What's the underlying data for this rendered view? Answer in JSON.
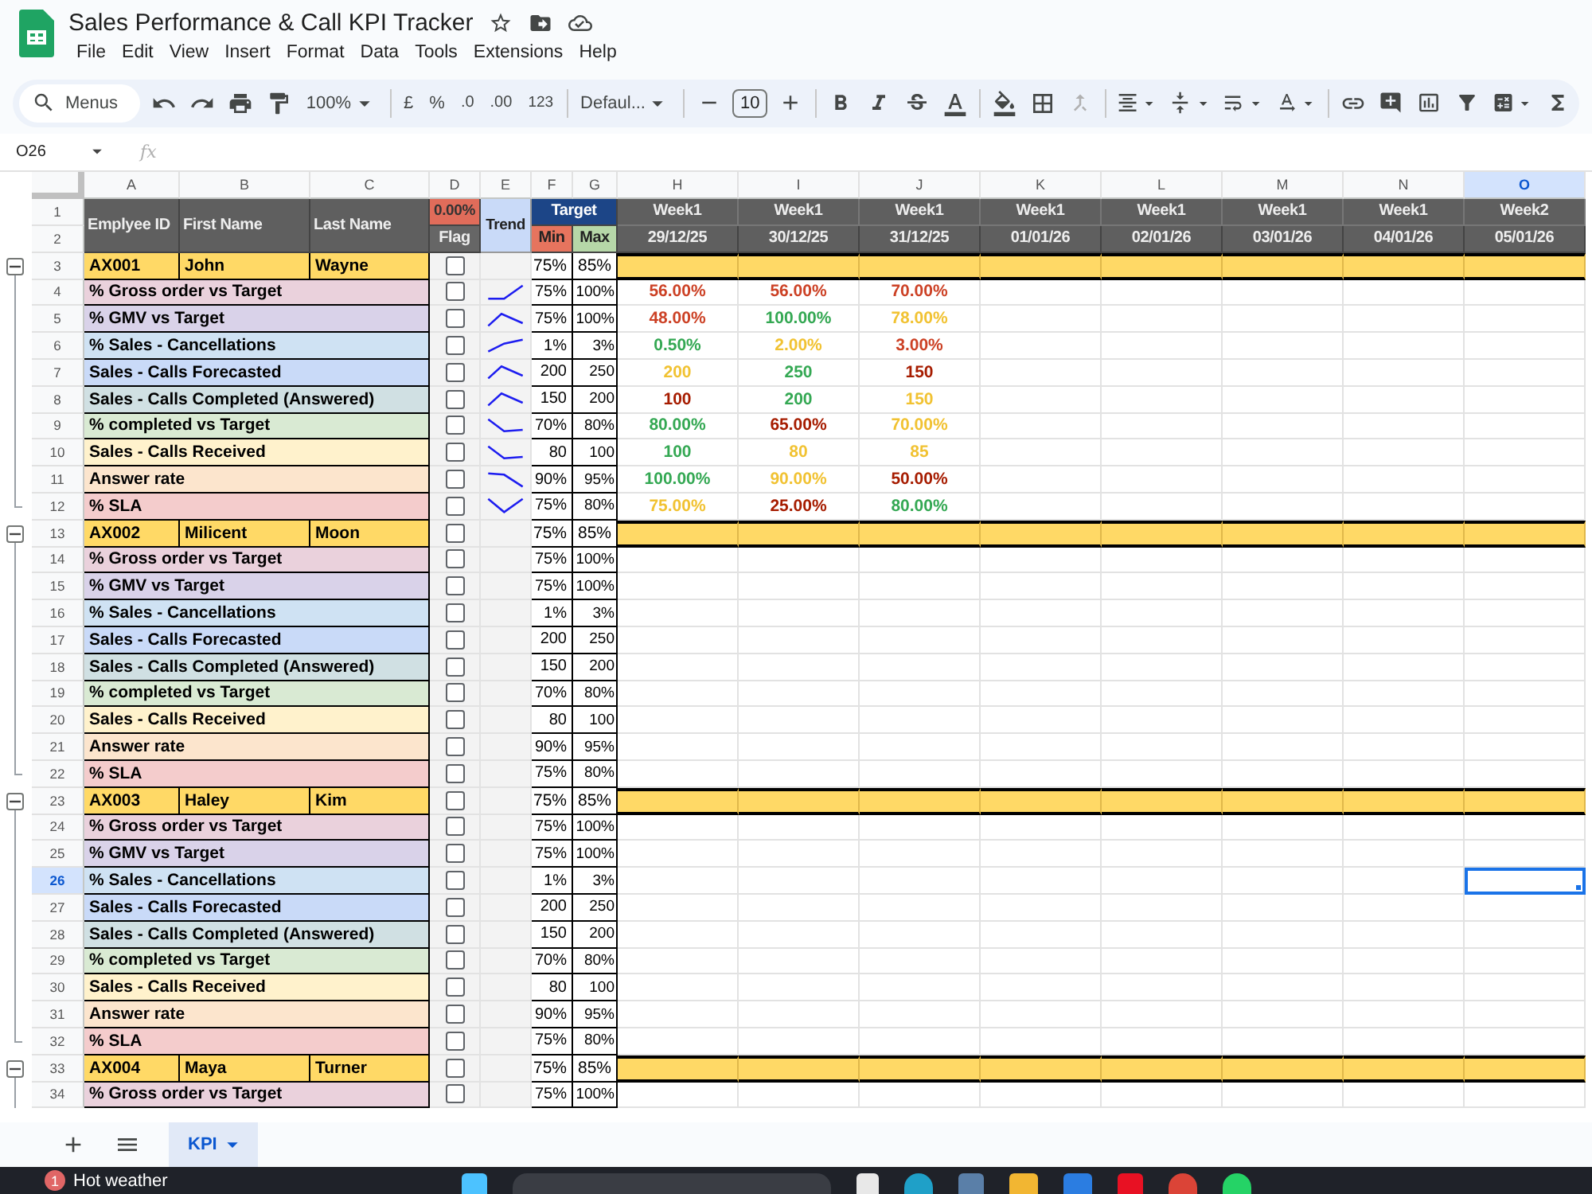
{
  "app": {
    "title": "Sales Performance & Call KPI Tracker"
  },
  "menu": [
    "File",
    "Edit",
    "View",
    "Insert",
    "Format",
    "Data",
    "Tools",
    "Extensions",
    "Help"
  ],
  "toolbar": {
    "search": "Menus",
    "zoom": "100%",
    "currency": "£",
    "percent": "%",
    "decrease_decimal": ".0",
    "increase_decimal": ".00",
    "number_format": "123",
    "font": "Defaul...",
    "font_size": "10"
  },
  "formula_bar": {
    "name_box": "O26",
    "label": "fx"
  },
  "columns": [
    {
      "label": "A",
      "selected": false
    },
    {
      "label": "B",
      "selected": false
    },
    {
      "label": "C",
      "selected": false
    },
    {
      "label": "D",
      "selected": false
    },
    {
      "label": "E",
      "selected": false
    },
    {
      "label": "F",
      "selected": false
    },
    {
      "label": "G",
      "selected": false
    },
    {
      "label": "H",
      "selected": false
    },
    {
      "label": "I",
      "selected": false
    },
    {
      "label": "J",
      "selected": false
    },
    {
      "label": "K",
      "selected": false
    },
    {
      "label": "L",
      "selected": false
    },
    {
      "label": "M",
      "selected": false
    },
    {
      "label": "N",
      "selected": false
    },
    {
      "label": "O",
      "selected": true
    }
  ],
  "header": {
    "employee_id": "Emplyee ID",
    "first_name": "First Name",
    "last_name": "Last Name",
    "flag_rate": "0.00%",
    "flag": "Flag",
    "trend": "Trend",
    "target": "Target",
    "min": "Min",
    "max": "Max"
  },
  "weeks": [
    {
      "week": "Week1",
      "date": "29/12/25"
    },
    {
      "week": "Week1",
      "date": "30/12/25"
    },
    {
      "week": "Week1",
      "date": "31/12/25"
    },
    {
      "week": "Week1",
      "date": "01/01/26"
    },
    {
      "week": "Week1",
      "date": "02/01/26"
    },
    {
      "week": "Week1",
      "date": "03/01/26"
    },
    {
      "week": "Week1",
      "date": "04/01/26"
    },
    {
      "week": "Week2",
      "date": "05/01/26"
    }
  ],
  "row_numbers": [
    {
      "label": "1",
      "selected": false
    },
    {
      "label": "2",
      "selected": false
    },
    {
      "label": "3",
      "selected": false
    },
    {
      "label": "4",
      "selected": false
    },
    {
      "label": "5",
      "selected": false
    },
    {
      "label": "6",
      "selected": false
    },
    {
      "label": "7",
      "selected": false
    },
    {
      "label": "8",
      "selected": false
    },
    {
      "label": "9",
      "selected": false
    },
    {
      "label": "10",
      "selected": false
    },
    {
      "label": "11",
      "selected": false
    },
    {
      "label": "12",
      "selected": false
    },
    {
      "label": "13",
      "selected": false
    },
    {
      "label": "14",
      "selected": false
    },
    {
      "label": "15",
      "selected": false
    },
    {
      "label": "16",
      "selected": false
    },
    {
      "label": "17",
      "selected": false
    },
    {
      "label": "18",
      "selected": false
    },
    {
      "label": "19",
      "selected": false
    },
    {
      "label": "20",
      "selected": false
    },
    {
      "label": "21",
      "selected": false
    },
    {
      "label": "22",
      "selected": false
    },
    {
      "label": "23",
      "selected": false
    },
    {
      "label": "24",
      "selected": false
    },
    {
      "label": "25",
      "selected": false
    },
    {
      "label": "26",
      "selected": true
    },
    {
      "label": "27",
      "selected": false
    },
    {
      "label": "28",
      "selected": false
    },
    {
      "label": "29",
      "selected": false
    },
    {
      "label": "30",
      "selected": false
    },
    {
      "label": "31",
      "selected": false
    },
    {
      "label": "32",
      "selected": false
    },
    {
      "label": "33",
      "selected": false
    },
    {
      "label": "34",
      "selected": false
    }
  ],
  "employees": [
    {
      "id": "AX001",
      "first_name": "John",
      "last_name": "Wayne",
      "expanded": true,
      "checked": false,
      "min": "75%",
      "max": "85%",
      "metrics": [
        {
          "name": "% Gross order vs Target",
          "color": "#ead1dc",
          "checked": false,
          "trend": {
            "kind": "flat-rise"
          },
          "min": "75%",
          "max": "100%",
          "values": [
            {
              "text": "56.00%",
              "color": "#cc4125"
            },
            {
              "text": "56.00%",
              "color": "#cc4125"
            },
            {
              "text": "70.00%",
              "color": "#cc4125"
            }
          ]
        },
        {
          "name": "% GMV vs Target",
          "color": "#d9d2e9",
          "checked": false,
          "trend": {
            "kind": "peak"
          },
          "min": "75%",
          "max": "100%",
          "values": [
            {
              "text": "48.00%",
              "color": "#cc4125"
            },
            {
              "text": "100.00%",
              "color": "#34a853"
            },
            {
              "text": "78.00%",
              "color": "#f1c232"
            }
          ]
        },
        {
          "name": "% Sales - Cancellations",
          "color": "#cfe2f3",
          "checked": false,
          "trend": {
            "kind": "rise"
          },
          "min": "1%",
          "max": "3%",
          "values": [
            {
              "text": "0.50%",
              "color": "#34a853"
            },
            {
              "text": "2.00%",
              "color": "#f1c232"
            },
            {
              "text": "3.00%",
              "color": "#cc4125"
            }
          ]
        },
        {
          "name": "Sales - Calls Forecasted",
          "color": "#c9daf8",
          "checked": false,
          "trend": {
            "kind": "peak"
          },
          "min": "200",
          "max": "250",
          "values": [
            {
              "text": "200",
              "color": "#f1c232"
            },
            {
              "text": "250",
              "color": "#34a853"
            },
            {
              "text": "150",
              "color": "#a61c00"
            }
          ]
        },
        {
          "name": "Sales - Calls Completed (Answered)",
          "color": "#d0e0e3",
          "checked": false,
          "trend": {
            "kind": "peak"
          },
          "min": "150",
          "max": "200",
          "values": [
            {
              "text": "100",
              "color": "#a61c00"
            },
            {
              "text": "200",
              "color": "#34a853"
            },
            {
              "text": "150",
              "color": "#f1c232"
            }
          ]
        },
        {
          "name": "% completed vs Target",
          "color": "#d9ead3",
          "checked": false,
          "trend": {
            "kind": "fall-flat"
          },
          "min": "70%",
          "max": "80%",
          "values": [
            {
              "text": "80.00%",
              "color": "#34a853"
            },
            {
              "text": "65.00%",
              "color": "#a61c00"
            },
            {
              "text": "70.00%",
              "color": "#f1c232"
            }
          ]
        },
        {
          "name": "Sales - Calls Received",
          "color": "#fff2cc",
          "checked": false,
          "trend": {
            "kind": "fall-flat"
          },
          "min": "80",
          "max": "100",
          "values": [
            {
              "text": "100",
              "color": "#34a853"
            },
            {
              "text": "80",
              "color": "#f1c232"
            },
            {
              "text": "85",
              "color": "#f1c232"
            }
          ]
        },
        {
          "name": "Answer rate",
          "color": "#fce5cd",
          "checked": false,
          "trend": {
            "kind": "fall"
          },
          "min": "90%",
          "max": "95%",
          "values": [
            {
              "text": "100.00%",
              "color": "#34a853"
            },
            {
              "text": "90.00%",
              "color": "#f1c232"
            },
            {
              "text": "50.00%",
              "color": "#a61c00"
            }
          ]
        },
        {
          "name": "% SLA",
          "color": "#f4cccc",
          "checked": false,
          "trend": {
            "kind": "valley"
          },
          "min": "75%",
          "max": "80%",
          "values": [
            {
              "text": "75.00%",
              "color": "#f1c232"
            },
            {
              "text": "25.00%",
              "color": "#a61c00"
            },
            {
              "text": "80.00%",
              "color": "#34a853"
            }
          ]
        }
      ]
    },
    {
      "id": "AX002",
      "first_name": "Milicent",
      "last_name": "Moon",
      "expanded": true,
      "checked": false,
      "min": "75%",
      "max": "85%",
      "metrics": [
        {
          "name": "% Gross order vs Target",
          "color": "#ead1dc",
          "checked": false,
          "min": "75%",
          "max": "100%"
        },
        {
          "name": "% GMV vs Target",
          "color": "#d9d2e9",
          "checked": false,
          "min": "75%",
          "max": "100%"
        },
        {
          "name": "% Sales - Cancellations",
          "color": "#cfe2f3",
          "checked": false,
          "min": "1%",
          "max": "3%"
        },
        {
          "name": "Sales - Calls Forecasted",
          "color": "#c9daf8",
          "checked": false,
          "min": "200",
          "max": "250"
        },
        {
          "name": "Sales - Calls Completed (Answered)",
          "color": "#d0e0e3",
          "checked": false,
          "min": "150",
          "max": "200"
        },
        {
          "name": "% completed vs Target",
          "color": "#d9ead3",
          "checked": false,
          "min": "70%",
          "max": "80%"
        },
        {
          "name": "Sales - Calls Received",
          "color": "#fff2cc",
          "checked": false,
          "min": "80",
          "max": "100"
        },
        {
          "name": "Answer rate",
          "color": "#fce5cd",
          "checked": false,
          "min": "90%",
          "max": "95%"
        },
        {
          "name": "% SLA",
          "color": "#f4cccc",
          "checked": false,
          "min": "75%",
          "max": "80%"
        }
      ]
    },
    {
      "id": "AX003",
      "first_name": "Haley",
      "last_name": "Kim",
      "expanded": true,
      "checked": false,
      "min": "75%",
      "max": "85%",
      "metrics": [
        {
          "name": "% Gross order vs Target",
          "color": "#ead1dc",
          "checked": false,
          "min": "75%",
          "max": "100%"
        },
        {
          "name": "% GMV vs Target",
          "color": "#d9d2e9",
          "checked": false,
          "min": "75%",
          "max": "100%"
        },
        {
          "name": "% Sales - Cancellations",
          "color": "#cfe2f3",
          "checked": false,
          "min": "1%",
          "max": "3%"
        },
        {
          "name": "Sales - Calls Forecasted",
          "color": "#c9daf8",
          "checked": false,
          "min": "200",
          "max": "250"
        },
        {
          "name": "Sales - Calls Completed (Answered)",
          "color": "#d0e0e3",
          "checked": false,
          "min": "150",
          "max": "200"
        },
        {
          "name": "% completed vs Target",
          "color": "#d9ead3",
          "checked": false,
          "min": "70%",
          "max": "80%"
        },
        {
          "name": "Sales - Calls Received",
          "color": "#fff2cc",
          "checked": false,
          "min": "80",
          "max": "100"
        },
        {
          "name": "Answer rate",
          "color": "#fce5cd",
          "checked": false,
          "min": "90%",
          "max": "95%"
        },
        {
          "name": "% SLA",
          "color": "#f4cccc",
          "checked": false,
          "min": "75%",
          "max": "80%"
        }
      ]
    },
    {
      "id": "AX004",
      "first_name": "Maya",
      "last_name": "Turner",
      "expanded": true,
      "checked": false,
      "min": "75%",
      "max": "85%",
      "metrics": [
        {
          "name": "% Gross order vs Target",
          "color": "#ead1dc",
          "checked": false,
          "min": "75%",
          "max": "100%"
        }
      ]
    }
  ],
  "sheets": [
    {
      "label": "KPI",
      "selected": true
    }
  ],
  "taskbar": {
    "badge": "1",
    "weather": "Hot weather"
  }
}
